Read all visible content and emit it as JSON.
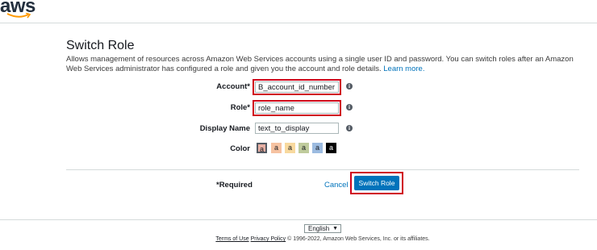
{
  "header": {
    "logo_text": "aws",
    "smile_color": "#ff9900"
  },
  "page": {
    "title": "Switch Role",
    "description": "Allows management of resources across Amazon Web Services accounts using a single user ID and password. You can switch roles after an Amazon Web Services administrator has configured a role and given you the account and role details.",
    "learn_more": "Learn more."
  },
  "form": {
    "account_label": "Account*",
    "account_value": "B_account_id_number",
    "role_label": "Role*",
    "role_value": "role_name",
    "display_name_label": "Display Name",
    "display_name_value": "text_to_display",
    "color_label": "Color",
    "info_icon": "i",
    "swatches": [
      {
        "letter": "a",
        "color": "#e7b0a4",
        "selected": true
      },
      {
        "letter": "a",
        "color": "#f6c2a1"
      },
      {
        "letter": "a",
        "color": "#f8d99e"
      },
      {
        "letter": "a",
        "color": "#bfcb9c"
      },
      {
        "letter": "a",
        "color": "#9cbbe0"
      },
      {
        "letter": "a",
        "color": "#000000"
      }
    ]
  },
  "actions": {
    "required_label": "*Required",
    "cancel_label": "Cancel",
    "switch_role_label": "Switch Role"
  },
  "footer": {
    "language": "English",
    "terms": "Terms of Use",
    "privacy": "Privacy Policy",
    "copyright": "© 1996-2022, Amazon Web Services, Inc. or its affiliates."
  }
}
